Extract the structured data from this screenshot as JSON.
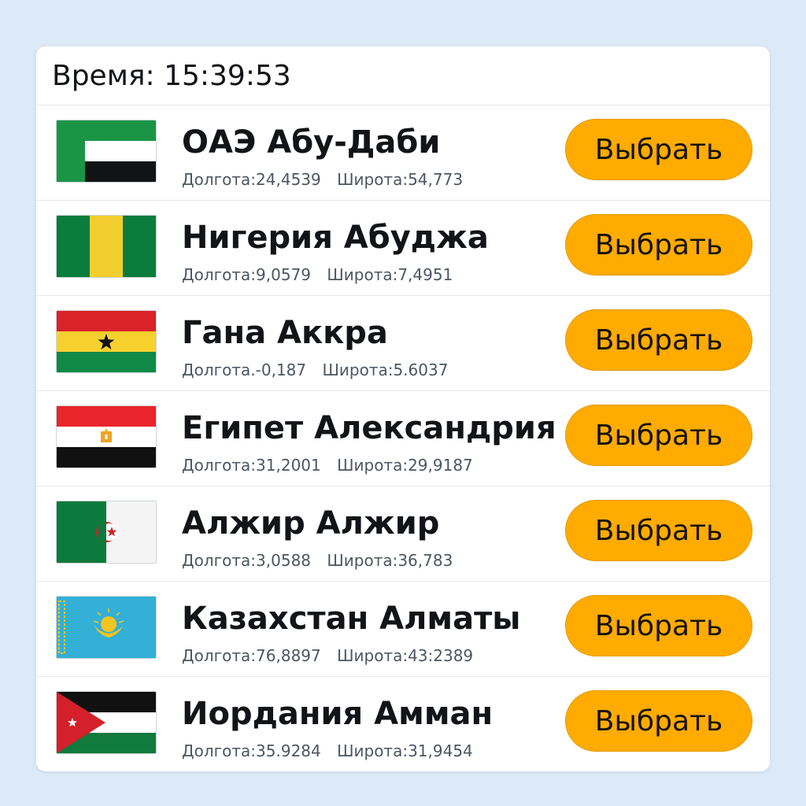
{
  "header": {
    "time_label": "Время: 15:39:53"
  },
  "select_label": "Выбрать",
  "cities": [
    {
      "name": "ОАЭ Абу-Даби",
      "lon": "Долгота:24,4539",
      "lat": "Широта:54,773",
      "flag": "uae-flag-icon"
    },
    {
      "name": "Нигерия Абуджа",
      "lon": "Долгота:9,0579",
      "lat": "Широта:7,4951",
      "flag": "nigeria-flag-icon"
    },
    {
      "name": "Гана Аккра",
      "lon": "Долгота.-0,187",
      "lat": "Широта:5.6037",
      "flag": "ghana-flag-icon"
    },
    {
      "name": "Египет Александрия",
      "lon": "Долгота:31,2001",
      "lat": "Широта:29,9187",
      "flag": "egypt-flag-icon"
    },
    {
      "name": "Алжир Алжир",
      "lon": "Долгота:3,0588",
      "lat": "Широта:36,783",
      "flag": "algeria-flag-icon"
    },
    {
      "name": "Казахстан Алматы",
      "lon": "Долгота:76,8897",
      "lat": "Широта:43:2389",
      "flag": "kazakhstan-flag-icon"
    },
    {
      "name": "Иордания Амман",
      "lon": "Долгота:35.9284",
      "lat": "Широта:31,9454",
      "flag": "jordan-flag-icon"
    }
  ],
  "colors": {
    "page_background": "#dce9f6",
    "button_accent": "#ffab00"
  }
}
